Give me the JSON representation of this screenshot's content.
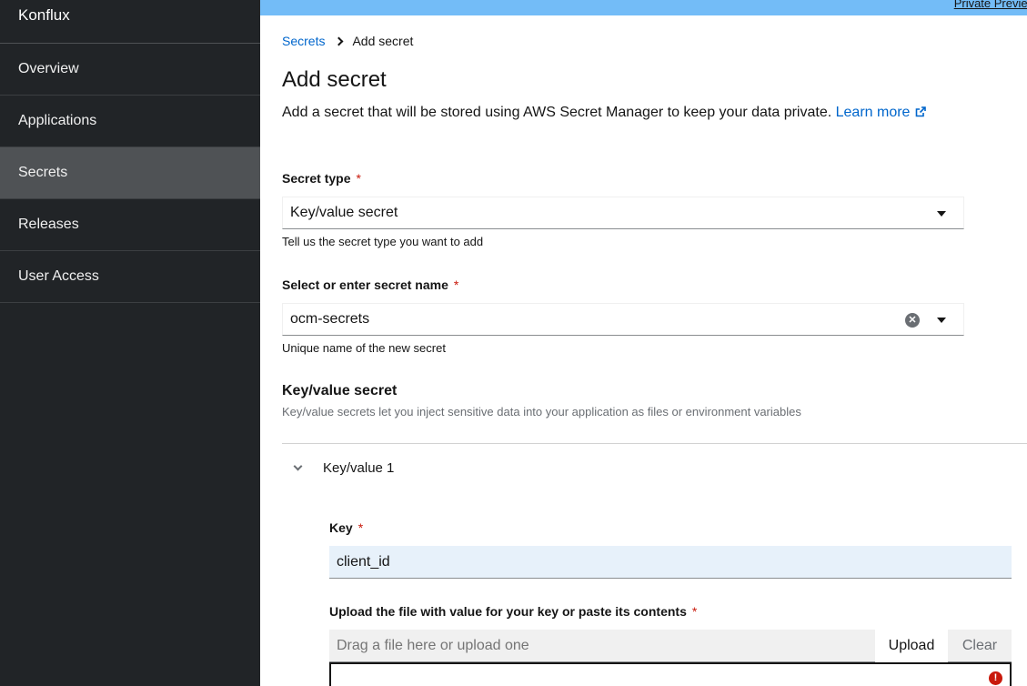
{
  "sidebar": {
    "brand": "Konflux",
    "items": [
      {
        "label": "Overview"
      },
      {
        "label": "Applications"
      },
      {
        "label": "Secrets"
      },
      {
        "label": "Releases"
      },
      {
        "label": "User Access"
      }
    ],
    "active": "Secrets"
  },
  "banner": {
    "link_text": "Private Preview"
  },
  "breadcrumb": {
    "parent": "Secrets",
    "current": "Add secret"
  },
  "page": {
    "title": "Add secret",
    "description": "Add a secret that will be stored using AWS Secret Manager to keep your data private.",
    "learn_more": "Learn more"
  },
  "form": {
    "secret_type": {
      "label": "Secret type",
      "value": "Key/value secret",
      "helper": "Tell us the secret type you want to add"
    },
    "secret_name": {
      "label": "Select or enter secret name",
      "value": "ocm-secrets",
      "helper": "Unique name of the new secret"
    },
    "section": {
      "title": "Key/value secret",
      "description": "Key/value secrets let you inject sensitive data into your application as files or environment variables"
    },
    "kv_pair": {
      "title": "Key/value 1",
      "key_label": "Key",
      "key_value": "client_id",
      "upload_label": "Upload the file with value for your key or paste its contents",
      "upload_placeholder": "Drag a file here or upload one",
      "upload_button": "Upload",
      "clear_button": "Clear"
    }
  },
  "required_marker": "*",
  "colors": {
    "sidebar_bg": "#212427",
    "active_item_bg": "#4f5255",
    "banner_bg": "#73bcf7",
    "link": "#0066cc",
    "required": "#c9190b"
  }
}
